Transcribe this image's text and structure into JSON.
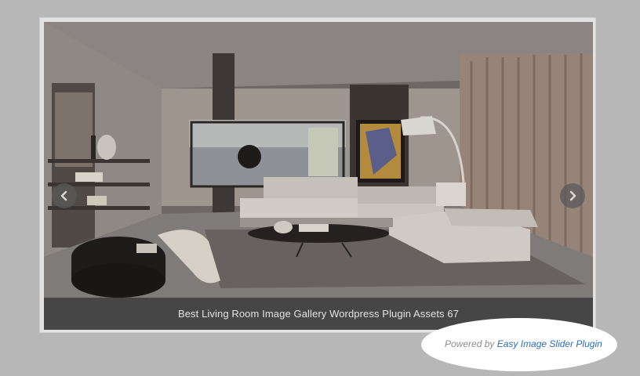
{
  "slider": {
    "caption": "Best Living Room Image Gallery Wordpress Plugin Assets 67",
    "prev_icon": "chevron-left-icon",
    "next_icon": "chevron-right-icon",
    "image_description": "living-room-photo"
  },
  "footer": {
    "powered_prefix": "Powered by",
    "powered_link": "Easy Image Slider Plugin"
  },
  "colors": {
    "page_background": "#b7b7b7",
    "caption_background": "#3a3a3a",
    "link": "#2f6fb0"
  }
}
